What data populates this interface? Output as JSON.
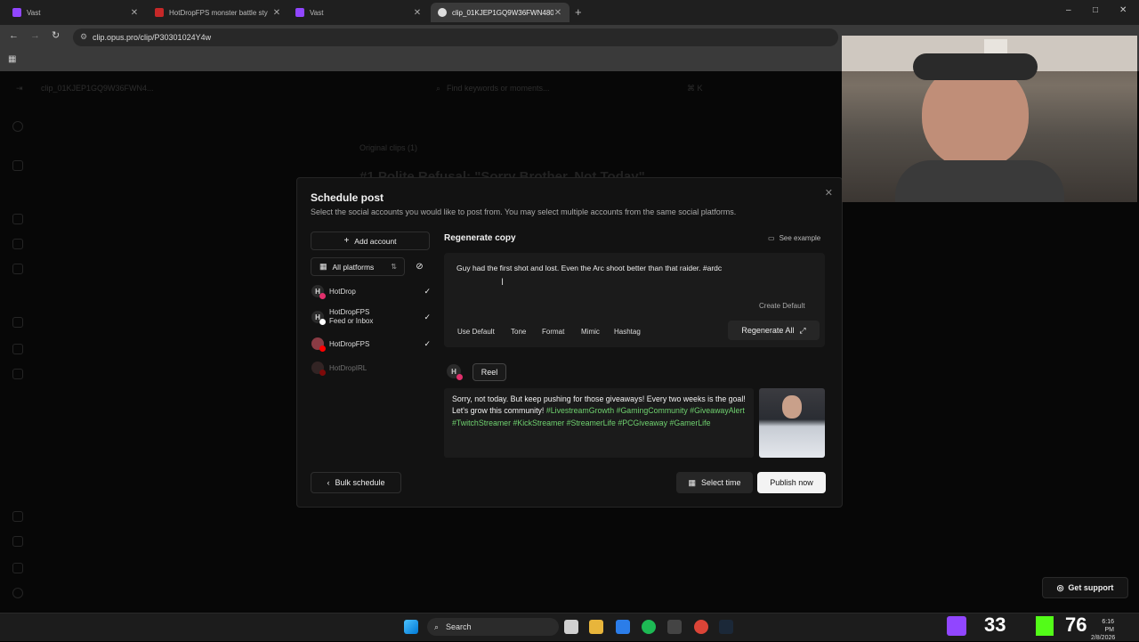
{
  "browser": {
    "tabs": [
      {
        "title": "Vast",
        "favicon_color": "#9146ff",
        "active": false
      },
      {
        "title": "HotDropFPS monster battle sty",
        "favicon_color": "#c62828",
        "active": false
      },
      {
        "title": "Vast",
        "favicon_color": "#9146ff",
        "active": false
      },
      {
        "title": "clip_01KJEP1GQ9W36FWN480",
        "favicon_color": "#dddddd",
        "active": true
      }
    ],
    "new_tab": "+",
    "url": "clip.opus.pro/clip/P30301024Y4w",
    "window_controls": {
      "minimize": "–",
      "maximize": "□",
      "close": "✕"
    }
  },
  "background_page": {
    "clip_name": "clip_01KJEP1GQ9W36FWN4...",
    "search_placeholder": "Find keywords or moments...",
    "search_shortcut": "⌘ K",
    "original_clips": "Original clips (1)",
    "clip_title": "#1 Polite Refusal: \"Sorry Brother, Not Today\""
  },
  "modal": {
    "title": "Schedule post",
    "subtitle": "Select the social accounts you would like to post from. You may select multiple accounts from the same social platforms.",
    "add_account": "Add account",
    "platform_filter": "All platforms",
    "accounts": [
      {
        "avatar_letter": "H",
        "name": "HotDrop",
        "sub": "",
        "checked": true,
        "avatar_color": "#2a2a2a",
        "badge_color": "#e1306c"
      },
      {
        "avatar_letter": "H",
        "name": "HotDropFPS",
        "sub": "Feed or Inbox",
        "checked": true,
        "avatar_color": "#2a2a2a",
        "badge_color": "#ffffff"
      },
      {
        "avatar_letter": "",
        "name": "HotDropFPS",
        "sub": "",
        "checked": true,
        "avatar_color": "#8a3b44",
        "badge_color": "#ff0000"
      },
      {
        "avatar_letter": "",
        "name": "HotDropIRL",
        "sub": "",
        "checked": false,
        "avatar_color": "#5a3a3a",
        "badge_color": "#ff0000",
        "dimmed": true
      }
    ],
    "regenerate_heading": "Regenerate copy",
    "see_example": "See example",
    "prompt_text": "Guy had the first shot and lost. Even the Arc shoot better than that raider. #ardc",
    "create_default": "Create Default",
    "options": [
      "Use Default",
      "Tone",
      "Format",
      "Mimic",
      "Hashtag"
    ],
    "regenerate_all": "Regenerate All",
    "post": {
      "avatar_letter": "H",
      "format_tab": "Reel",
      "caption_text": "Sorry, not today. But keep pushing for those giveaways! Every two weeks is the goal! Let's grow this community!",
      "hashtags": [
        "#LivestreamGrowth",
        "#GamingCommunity",
        "#GiveawayAlert",
        "#TwitchStreamer",
        "#KickStreamer",
        "#StreamerLife",
        "#PCGiveaway",
        "#GamerLife"
      ]
    },
    "bulk_schedule": "Bulk schedule",
    "select_time": "Select time",
    "publish_now": "Publish now"
  },
  "get_support": "Get support",
  "taskbar": {
    "search_label": "Search",
    "twitch_count": "33",
    "kick_count": "76",
    "time": "6:16 PM",
    "date": "2/8/2026"
  },
  "colors": {
    "accent_hashtag": "#6fd16f",
    "twitch": "#9146ff",
    "kick": "#53fc18"
  }
}
